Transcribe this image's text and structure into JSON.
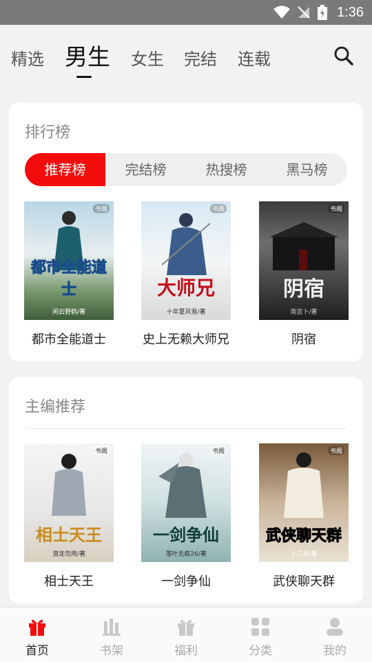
{
  "status_bar": {
    "time": "1:36"
  },
  "top_tabs": [
    {
      "label": "精选"
    },
    {
      "label": "男生"
    },
    {
      "label": "女生"
    },
    {
      "label": "完结"
    },
    {
      "label": "连载"
    }
  ],
  "ranking": {
    "title": "排行榜",
    "tabs": [
      {
        "label": "推荐榜"
      },
      {
        "label": "完结榜"
      },
      {
        "label": "热搜榜"
      },
      {
        "label": "黑马榜"
      }
    ],
    "books": [
      {
        "name": "都市全能道士",
        "cover_title": "都市全能道士",
        "cover_author": "闲云野鹤/著"
      },
      {
        "name": "史上无赖大师兄",
        "cover_title": "大师兄",
        "cover_author": "十年夏风雪/著"
      },
      {
        "name": "阴宿",
        "cover_title": "阴宿",
        "cover_author": "南宫卜/著"
      }
    ]
  },
  "editor_picks": {
    "title": "主编推荐",
    "books": [
      {
        "name": "相士天王",
        "cover_title": "相士天王",
        "cover_author": "潜龙勿用/著"
      },
      {
        "name": "一剑争仙",
        "cover_title": "一剑争仙",
        "cover_author": "落叶无痕26/著"
      },
      {
        "name": "武侠聊天群",
        "cover_title": "武侠聊天群",
        "cover_author": "十三叔/著"
      }
    ]
  },
  "bottom_nav": [
    {
      "label": "首页"
    },
    {
      "label": "书架"
    },
    {
      "label": "福利"
    },
    {
      "label": "分类"
    },
    {
      "label": "我的"
    }
  ],
  "cover_logo": "书阁",
  "colors": {
    "accent": "#f20c0c",
    "card_bg": "#ffffff",
    "page_bg": "#f2f2f2"
  }
}
